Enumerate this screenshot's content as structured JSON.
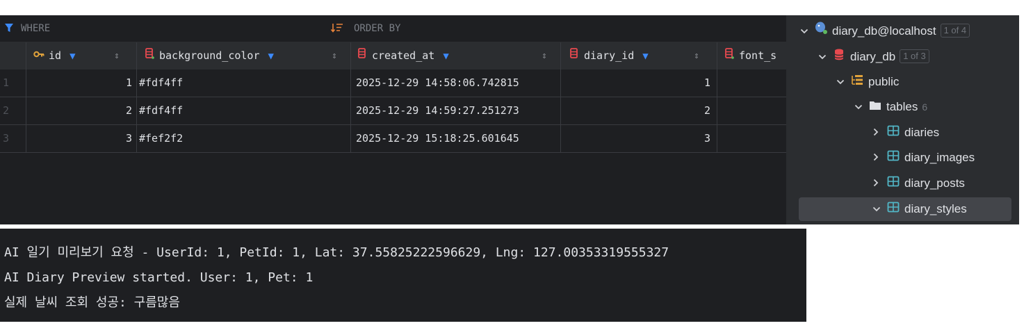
{
  "filter": {
    "where_label": "WHERE",
    "order_by_label": "ORDER BY"
  },
  "columns": {
    "id": "id",
    "background_color": "background_color",
    "created_at": "created_at",
    "diary_id": "diary_id",
    "font_s": "font_s"
  },
  "rows": [
    {
      "num": "1",
      "id": "1",
      "background_color": "#fdf4ff",
      "created_at": "2025-12-29 14:58:06.742815",
      "diary_id": "1"
    },
    {
      "num": "2",
      "id": "2",
      "background_color": "#fdf4ff",
      "created_at": "2025-12-29 14:59:27.251273",
      "diary_id": "2"
    },
    {
      "num": "3",
      "id": "3",
      "background_color": "#fef2f2",
      "created_at": "2025-12-29 15:18:25.601645",
      "diary_id": "3"
    }
  ],
  "tree": {
    "connection": {
      "label": "diary_db@localhost",
      "badge": "1 of 4"
    },
    "database": {
      "label": "diary_db",
      "badge": "1 of 3"
    },
    "schema": {
      "label": "public"
    },
    "folder": {
      "label": "tables",
      "count": "6"
    },
    "tables": [
      {
        "label": "diaries"
      },
      {
        "label": "diary_images"
      },
      {
        "label": "diary_posts"
      },
      {
        "label": "diary_styles"
      }
    ]
  },
  "console": {
    "lines": [
      "AI 일기 미리보기 요청 - UserId: 1, PetId: 1, Lat: 37.55825222596629, Lng: 127.00353319555327",
      "AI Diary Preview started. User: 1, Pet: 1",
      "실제 날씨 조회 성공: 구름많음"
    ]
  },
  "colors": {
    "accent_blue": "#3d8bfd",
    "key_icon": "#e0a23b",
    "column_icon": "#e8494f",
    "grid_bg": "#1e1f22",
    "tree_bg": "#2b2d30"
  },
  "icons": {
    "where": "filter-icon",
    "order_by": "sort-icon",
    "key": "primary-key-icon",
    "column": "column-icon",
    "connection": "postgresql-icon",
    "database": "database-icon",
    "schema": "schema-icon",
    "folder": "folder-icon",
    "table": "table-icon"
  }
}
